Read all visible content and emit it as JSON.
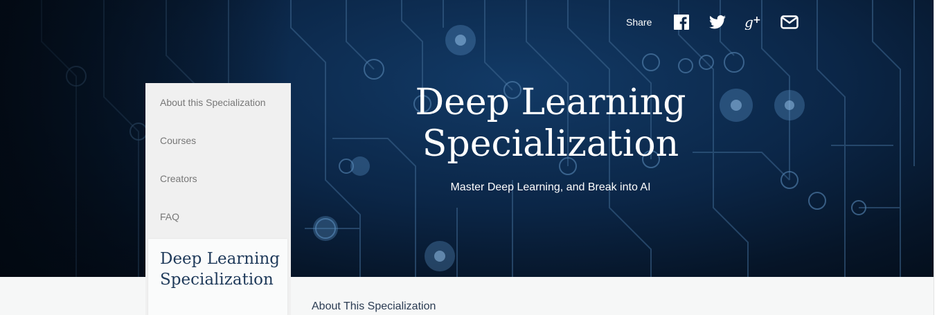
{
  "share": {
    "label": "Share",
    "icons": [
      "facebook-icon",
      "twitter-icon",
      "google-plus-icon",
      "email-icon"
    ]
  },
  "hero": {
    "title_line1": "Deep Learning",
    "title_line2": "Specialization",
    "subtitle": "Master Deep Learning, and Break into AI"
  },
  "sidenav": {
    "items": [
      "About this Specialization",
      "Courses",
      "Creators",
      "FAQ"
    ],
    "card_title": "Deep Learning Specialization"
  },
  "main": {
    "about_heading": "About This Specialization"
  },
  "colors": {
    "hero_bg": "#0b2647",
    "circuit": "#3e6790",
    "nav_bg": "#f0f0f0",
    "heading_text": "#1f3a5a"
  }
}
